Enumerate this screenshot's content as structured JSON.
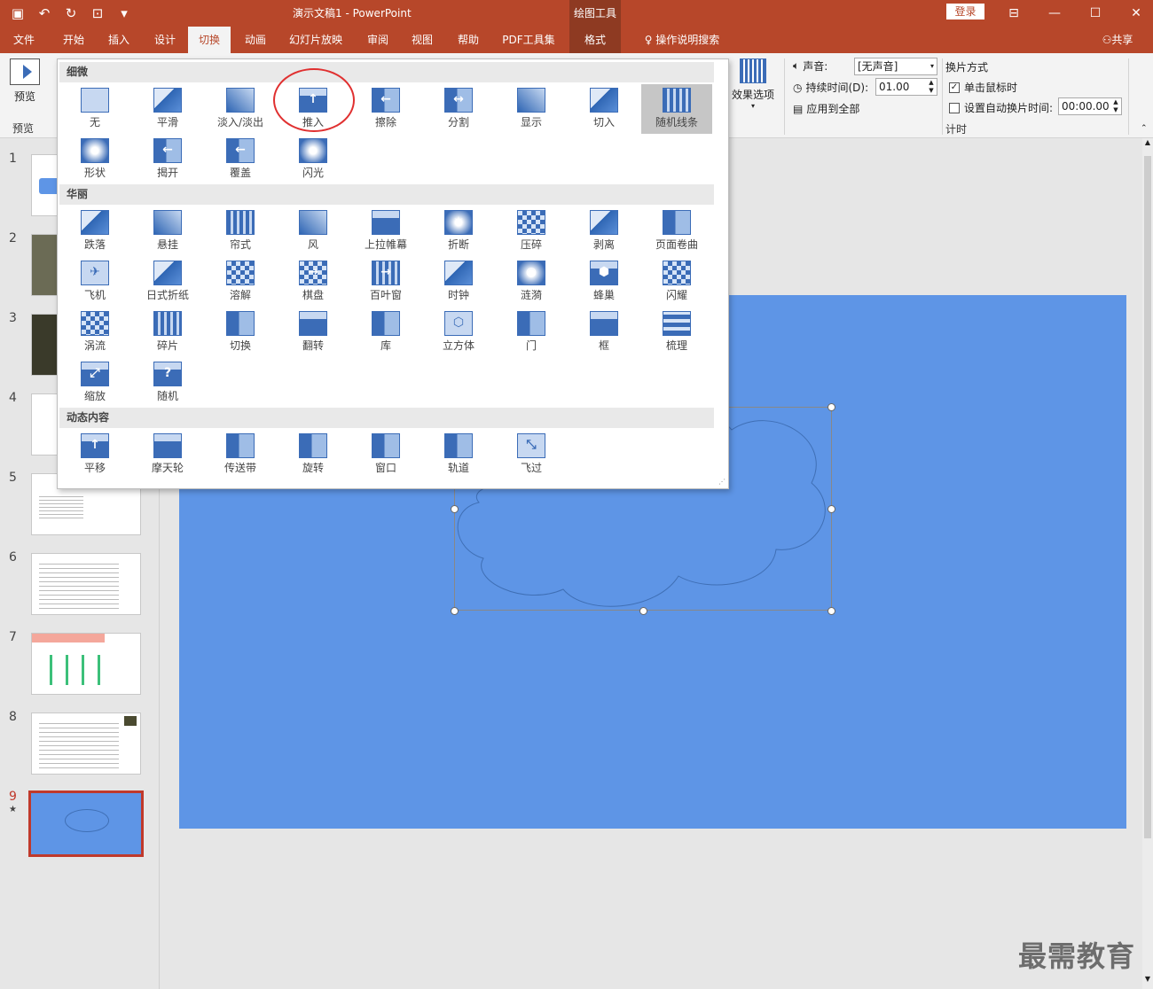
{
  "titlebar": {
    "doc_title": "演示文稿1  -  PowerPoint",
    "context_tool": "绘图工具",
    "login": "登录"
  },
  "tabs": [
    "文件",
    "开始",
    "插入",
    "设计",
    "切换",
    "动画",
    "幻灯片放映",
    "审阅",
    "视图",
    "帮助",
    "PDF工具集",
    "格式"
  ],
  "tell_me": "操作说明搜索",
  "share": "共享",
  "ribbon": {
    "preview_button": "预览",
    "preview_group": "预览",
    "effect_options": "效果选项",
    "sound_label": "声音:",
    "sound_value": "[无声音]",
    "duration_label": "持续时间(D):",
    "duration_value": "01.00",
    "apply_all": "应用到全部",
    "advance_title": "换片方式",
    "on_click": "单击鼠标时",
    "after_label": "设置自动换片时间:",
    "after_value": "00:00.00",
    "timing_group": "计时"
  },
  "gallery": {
    "subtle_title": "细微",
    "subtle": [
      "无",
      "平滑",
      "淡入/淡出",
      "推入",
      "擦除",
      "分割",
      "显示",
      "切入",
      "随机线条",
      "形状",
      "揭开",
      "覆盖",
      "闪光"
    ],
    "exciting_title": "华丽",
    "exciting": [
      "跌落",
      "悬挂",
      "帘式",
      "风",
      "上拉帷幕",
      "折断",
      "压碎",
      "剥离",
      "页面卷曲",
      "飞机",
      "日式折纸",
      "溶解",
      "棋盘",
      "百叶窗",
      "时钟",
      "涟漪",
      "蜂巢",
      "闪耀",
      "涡流",
      "碎片",
      "切换",
      "翻转",
      "库",
      "立方体",
      "门",
      "框",
      "梳理",
      "缩放",
      "随机"
    ],
    "dynamic_title": "动态内容",
    "dynamic": [
      "平移",
      "摩天轮",
      "传送带",
      "旋转",
      "窗口",
      "轨道",
      "飞过"
    ]
  },
  "thumbnails": [
    "1",
    "2",
    "3",
    "4",
    "5",
    "6",
    "7",
    "8",
    "9"
  ],
  "watermark": "最需教育"
}
